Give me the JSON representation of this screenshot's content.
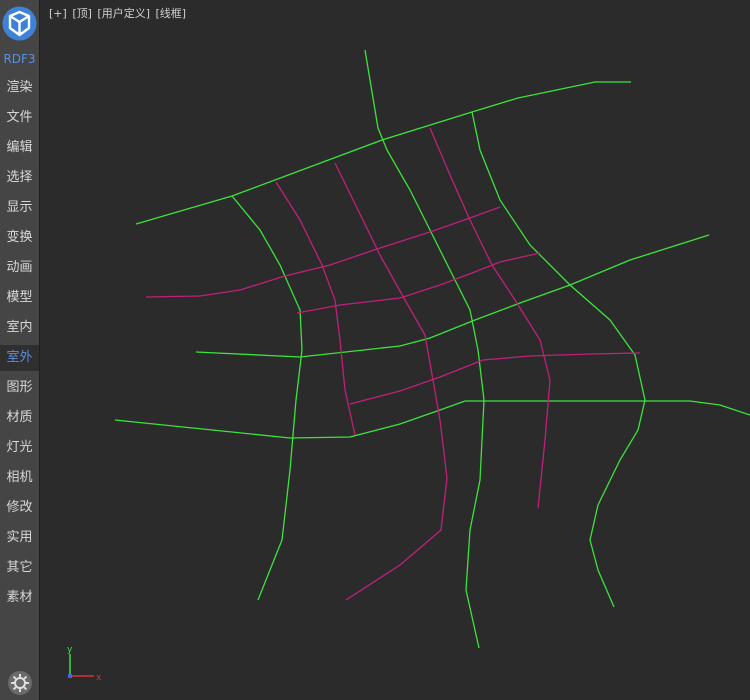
{
  "sidebar": {
    "brand": "RDF3",
    "items": [
      {
        "label": "渲染"
      },
      {
        "label": "文件"
      },
      {
        "label": "编辑"
      },
      {
        "label": "选择"
      },
      {
        "label": "显示"
      },
      {
        "label": "变换"
      },
      {
        "label": "动画"
      },
      {
        "label": "模型"
      },
      {
        "label": "室内"
      },
      {
        "label": "室外",
        "active": true
      },
      {
        "label": "图形"
      },
      {
        "label": "材质"
      },
      {
        "label": "灯光"
      },
      {
        "label": "相机"
      },
      {
        "label": "修改"
      },
      {
        "label": "实用"
      },
      {
        "label": "其它"
      },
      {
        "label": "素材"
      }
    ]
  },
  "viewport": {
    "labels": [
      "[+]",
      "[顶]",
      "[用户定义]",
      "[线框]"
    ]
  },
  "colors": {
    "sidebar_bg": "#454545",
    "viewport_bg": "#2b2b2b",
    "accent": "#5b8fe0",
    "green_road": "#3ce33c",
    "magenta_road": "#c0207a"
  },
  "axis_gizmo": {
    "y_label": "y",
    "x_label": "x"
  }
}
